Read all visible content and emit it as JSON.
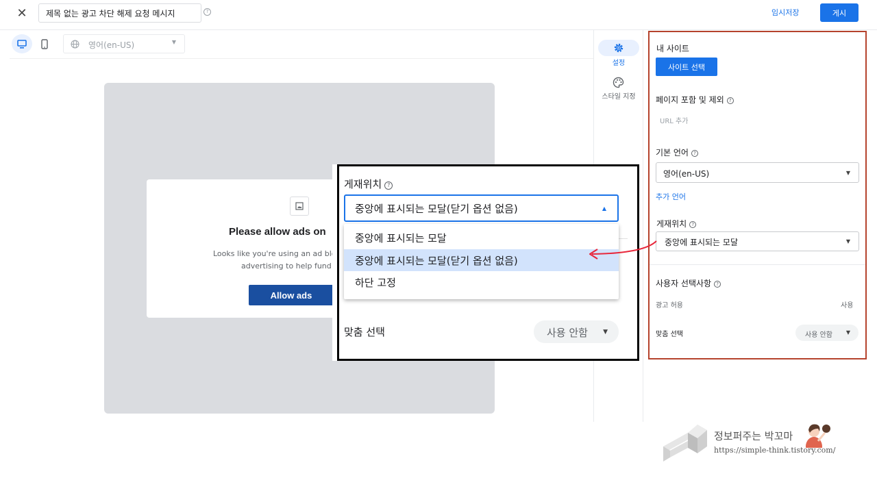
{
  "topbar": {
    "close_icon": "close-icon",
    "title_value": "제목 없는 광고 차단 해제 요청 메시지",
    "draft_label": "임시저장",
    "publish_label": "게시"
  },
  "preview_toolbar": {
    "desktop_icon": "desktop-icon",
    "mobile_icon": "mobile-icon",
    "language_value": "영어(en-US)"
  },
  "preview_card": {
    "title": "Please allow ads on",
    "desc_line1": "Looks like you're using an ad bloc",
    "desc_line2": "advertising to help fund o",
    "allow_button": "Allow ads"
  },
  "side_nav": {
    "settings_label": "설정",
    "style_label": "스타일 지정"
  },
  "settings": {
    "my_site_label": "내 사이트",
    "site_select_button": "사이트 선택",
    "page_incl_label": "페이지 포함 및 제외",
    "url_add": "URL 추가",
    "default_lang_label": "기본 언어",
    "default_lang_value": "영어(en-US)",
    "add_lang": "추가 언어",
    "position_label": "게재위치",
    "position_value": "중앙에 표시되는 모달",
    "user_choice_label": "사용자 선택사항",
    "allow_ads_label": "광고 허용",
    "allow_ads_value": "사용",
    "custom_choice_label": "맞춤 선택",
    "custom_choice_value": "사용 안함"
  },
  "zoom": {
    "position_label": "게재위치",
    "selected_value": "중앙에 표시되는 모달(닫기 옵션 없음)",
    "options": [
      "중앙에 표시되는 모달",
      "중앙에 표시되는 모달(닫기 옵션 없음)",
      "하단 고정"
    ],
    "custom_choice_label": "맞춤 선택",
    "custom_choice_value": "사용 안함"
  },
  "watermark": {
    "title": "정보퍼주는 박꼬마",
    "url": "https://simple-think.tistory.com/"
  },
  "colors": {
    "accent": "#1a73e8",
    "highlight_border": "#b5422c",
    "arrow": "#e8283c"
  }
}
